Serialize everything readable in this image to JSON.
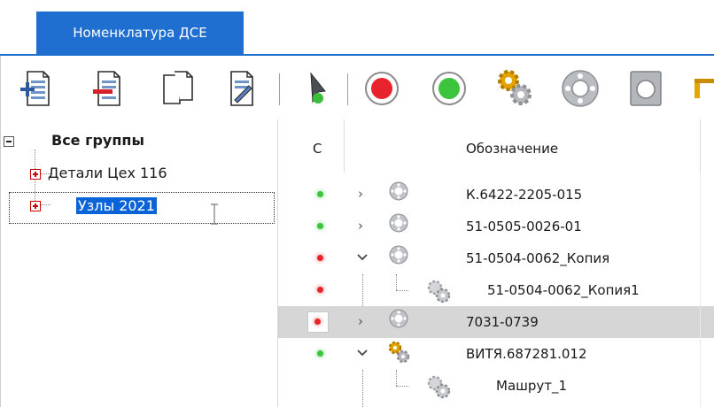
{
  "tab": {
    "label": "Номенклатура ДСЕ"
  },
  "toolbar": {
    "buttons": [
      {
        "icon": "add-document-icon"
      },
      {
        "icon": "remove-document-icon"
      },
      {
        "icon": "copy-document-icon"
      },
      {
        "icon": "edit-document-icon"
      },
      {
        "icon": "pointer-green-icon"
      },
      {
        "icon": "red-record-icon"
      },
      {
        "icon": "green-record-icon"
      },
      {
        "icon": "gears-icon"
      },
      {
        "icon": "part-gear-icon"
      },
      {
        "icon": "box-icon"
      }
    ]
  },
  "tree": {
    "root": "Все группы",
    "children": [
      "Детали Цех 116",
      "Узлы 2021"
    ]
  },
  "grid": {
    "columns": {
      "status": "С",
      "designation": "Обозначение"
    },
    "rows": [
      {
        "status": "green",
        "expander": "collapsed",
        "icon": "part-icon",
        "designation": "К.6422-2205-015"
      },
      {
        "status": "green",
        "expander": "collapsed",
        "icon": "part-icon",
        "designation": "51-0505-0026-01"
      },
      {
        "status": "red",
        "expander": "expanded",
        "icon": "part-icon",
        "designation": "51-0504-0062_Копия"
      },
      {
        "status": "red",
        "expander": "none",
        "icon": "route-icon",
        "designation": "51-0504-0062_Копия1"
      },
      {
        "status": "red",
        "expander": "collapsed",
        "icon": "part-icon",
        "designation": "7031-0739",
        "selected": true
      },
      {
        "status": "green",
        "expander": "expanded",
        "icon": "gears-icon",
        "designation": "ВИТЯ.687281.012"
      },
      {
        "status": "none",
        "expander": "none",
        "icon": "route-icon",
        "designation": "Машрут_1"
      }
    ]
  },
  "colors": {
    "accent": "#1e6fd0",
    "selection": "#0a64d8",
    "row_selected": "#d6d6d6",
    "status_green": "#3cc43c",
    "status_red": "#e8232b"
  }
}
